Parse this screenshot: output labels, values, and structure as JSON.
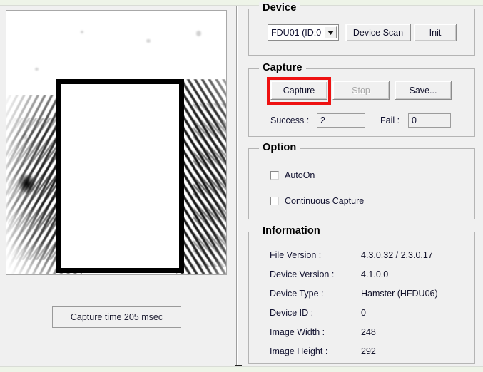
{
  "window": {
    "background_color": "#f0f0f0",
    "accent_highlight_color": "#ee1111"
  },
  "preview": {
    "capture_time_label": "Capture time 205 msec",
    "image_alt": "fingerprint-scan-preview"
  },
  "device": {
    "group_title": "Device",
    "combo_value": "FDU01 (ID:0",
    "combo_arrow_icon": "chevron-down-icon",
    "device_scan_label": "Device Scan",
    "init_label": "Init"
  },
  "capture": {
    "group_title": "Capture",
    "capture_label": "Capture",
    "stop_label": "Stop",
    "save_label": "Save...",
    "success_label": "Success :",
    "success_value": "2",
    "fail_label": "Fail :",
    "fail_value": "0"
  },
  "option": {
    "group_title": "Option",
    "items": [
      {
        "label": "AutoOn",
        "checked": false
      },
      {
        "label": "Continuous Capture",
        "checked": false
      }
    ]
  },
  "information": {
    "group_title": "Information",
    "rows": [
      {
        "label": "File Version :",
        "value": "4.3.0.32 / 2.3.0.17"
      },
      {
        "label": "Device Version :",
        "value": "4.1.0.0"
      },
      {
        "label": "Device Type :",
        "value": "Hamster (HFDU06)"
      },
      {
        "label": "Device ID :",
        "value": "0"
      },
      {
        "label": "Image Width :",
        "value": "248"
      },
      {
        "label": "Image Height :",
        "value": "292"
      }
    ]
  }
}
